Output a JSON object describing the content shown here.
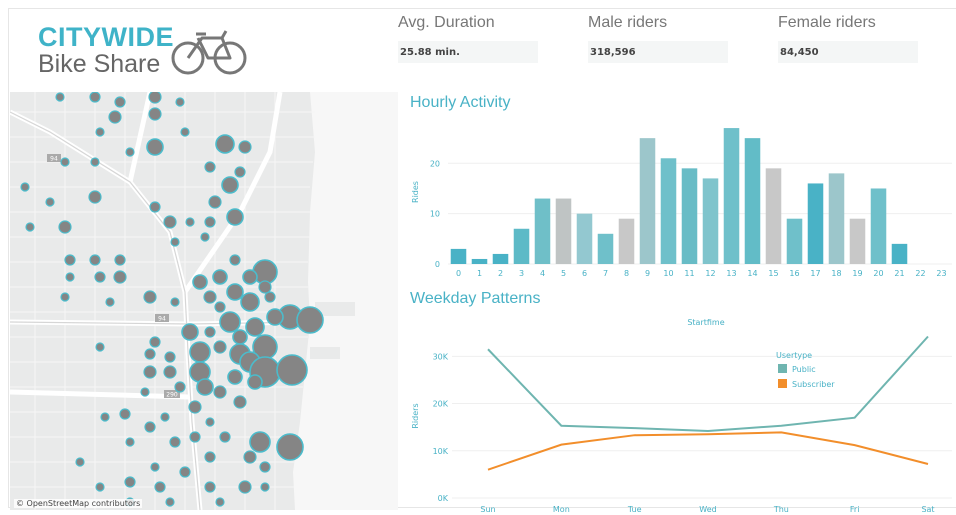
{
  "logo": {
    "line1": "CITYWIDE",
    "line2": "Bike Share",
    "icon": "bicycle-icon"
  },
  "kpis": [
    {
      "title": "Avg. Duration",
      "value": "25.88 min."
    },
    {
      "title": "Male riders",
      "value": "318,596"
    },
    {
      "title": "Female riders",
      "value": "84,450"
    }
  ],
  "map": {
    "credit": "© OpenStreetMap contributors",
    "highway_labels": [
      "94",
      "94",
      "290"
    ]
  },
  "hourly": {
    "title": "Hourly Activity"
  },
  "weekday": {
    "title": "Weekday Patterns"
  },
  "colors": {
    "teal": "#49b2c6",
    "teal_light": "#93c8d0",
    "gray_bar": "#c8c8c8",
    "public": "#6fb5b0",
    "subscriber": "#f28e2b",
    "station": "#858585"
  },
  "chart_data": [
    {
      "type": "bar",
      "title": "Hourly Activity",
      "ylabel": "Rides",
      "categories": [
        "0",
        "1",
        "2",
        "3",
        "4",
        "5",
        "6",
        "7",
        "8",
        "9",
        "10",
        "11",
        "12",
        "13",
        "14",
        "15",
        "16",
        "17",
        "18",
        "19",
        "20",
        "21",
        "22",
        "23"
      ],
      "values": [
        3,
        1,
        2,
        7,
        13,
        13,
        10,
        6,
        9,
        25,
        21,
        19,
        17,
        27,
        25,
        19,
        9,
        16,
        18,
        9,
        15,
        4,
        0,
        0
      ],
      "yticks": [
        "0",
        "10",
        "20"
      ],
      "ylim": [
        0,
        29
      ],
      "grid": true
    },
    {
      "type": "line",
      "title": "Startfime",
      "ylabel": "Riders",
      "categories": [
        "Sun",
        "Mon",
        "Tue",
        "Wed",
        "Thu",
        "Fri",
        "Sat"
      ],
      "legend_title": "Usertype",
      "legend_position": "top-right",
      "series": [
        {
          "name": "Public",
          "values": [
            31500,
            15300,
            14800,
            14200,
            15300,
            17000,
            34200
          ]
        },
        {
          "name": "Subscriber",
          "values": [
            6000,
            11300,
            13300,
            13500,
            13900,
            11200,
            7200
          ]
        }
      ],
      "yticks": [
        "0K",
        "10K",
        "20K",
        "30K"
      ],
      "ylim": [
        0,
        36000
      ],
      "grid": true
    }
  ]
}
